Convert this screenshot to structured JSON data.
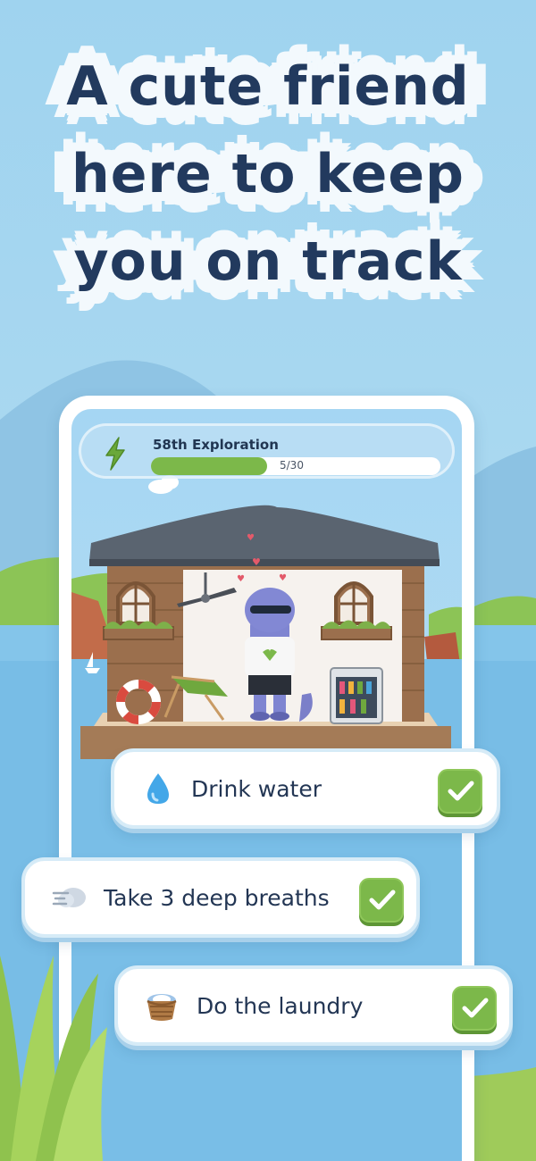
{
  "headline": {
    "line1": "A cute friend",
    "line2": "here to keep",
    "line3": "you on track"
  },
  "exploration": {
    "title": "58th Exploration",
    "progress_text": "5/30",
    "progress_fraction": 0.4,
    "icon": "lightning-bolt-icon"
  },
  "tasks": [
    {
      "label": "Drink water",
      "icon": "water-drop-icon",
      "checked": true
    },
    {
      "label": "Take 3 deep breaths",
      "icon": "wind-cloud-icon",
      "checked": true
    },
    {
      "label": "Do the laundry",
      "icon": "laundry-basket-icon",
      "checked": true
    }
  ],
  "colors": {
    "headline_text": "#223a5e",
    "accent_green": "#7cb84a",
    "sky": "#a5d6f3",
    "water": "#78bde6"
  }
}
